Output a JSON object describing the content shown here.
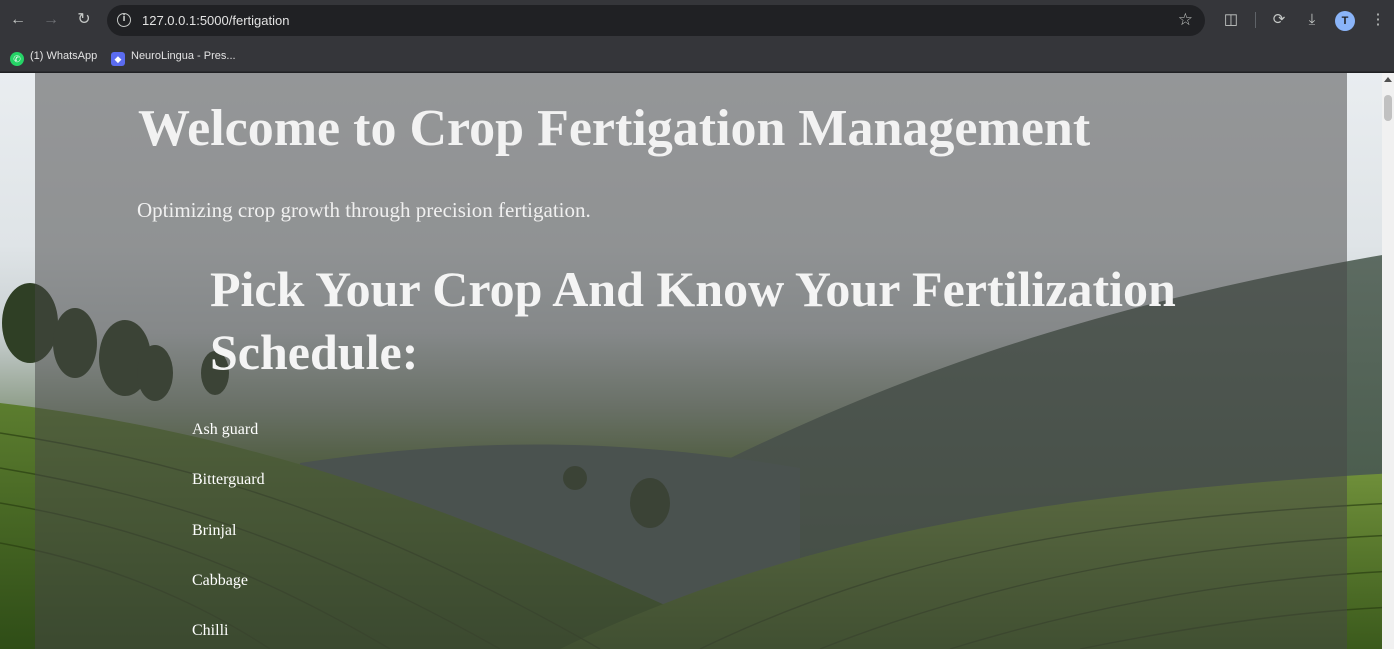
{
  "browser": {
    "url": "127.0.0.1:5000/fertigation",
    "avatar_letter": "T",
    "bookmarks": [
      {
        "label": "(1) WhatsApp",
        "icon": "whatsapp-icon"
      },
      {
        "label": "NeuroLingua - Pres...",
        "icon": "neurolingua-icon"
      }
    ]
  },
  "page": {
    "title": "Welcome to Crop Fertigation Management",
    "subtitle": "Optimizing crop growth through precision fertigation.",
    "section_heading": "Pick Your Crop And Know Your Fertilization Schedule:",
    "crops": [
      "Ash guard",
      "Bitterguard",
      "Brinjal",
      "Cabbage",
      "Chilli"
    ]
  }
}
